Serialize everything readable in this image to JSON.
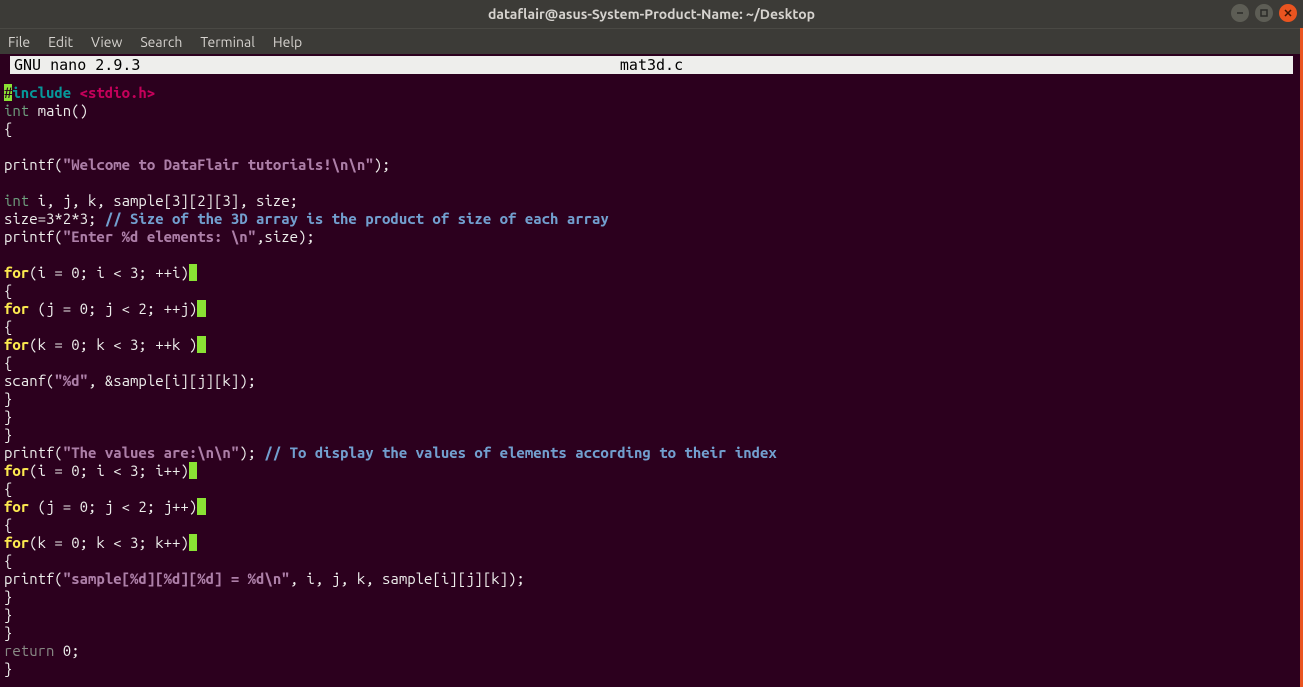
{
  "titlebar": {
    "title": "dataflair@asus-System-Product-Name: ~/Desktop"
  },
  "menubar": {
    "items": [
      "File",
      "Edit",
      "View",
      "Search",
      "Terminal",
      "Help"
    ]
  },
  "nano": {
    "editor": "  GNU nano 2.9.3",
    "filename": "mat3d.c"
  },
  "code": {
    "l1a": "#",
    "l1b": "include ",
    "l1c": "<stdio.h>",
    "l2a": "int",
    "l2b": " main()",
    "l3": "{",
    "l4": "",
    "l5a": "printf(",
    "l5b": "\"Welcome to DataFlair tutorials!\\n\\n\"",
    "l5c": ");",
    "l6": "",
    "l7a": "int",
    "l7b": " i, j, k, sample[3][2][3], size;",
    "l8a": "size=3*2*3; ",
    "l8b": "// Size of the 3D array is the product of size of each array",
    "l9a": "printf(",
    "l9b": "\"Enter %d elements: \\n\"",
    "l9c": ",size);",
    "l10": "",
    "l11a": "for",
    "l11b": "(i = 0; i < 3; ++i)",
    "l11c": " ",
    "l12": "{",
    "l13a": "for",
    "l13b": " (j = 0; j < 2; ++j)",
    "l13c": " ",
    "l14": "{",
    "l15a": "for",
    "l15b": "(k = 0; k < 3; ++k )",
    "l15c": " ",
    "l16": "{",
    "l17a": "scanf(",
    "l17b": "\"%d\"",
    "l17c": ", &sample[i][j][k]);",
    "l18": "}",
    "l19": "}",
    "l20": "}",
    "l21a": "printf(",
    "l21b": "\"The values are:\\n\\n\"",
    "l21c": "); ",
    "l21d": "// To display the values of elements according to their index",
    "l22a": "for",
    "l22b": "(i = 0; i < 3; i++)",
    "l22c": " ",
    "l23": "{",
    "l24a": "for",
    "l24b": " (j = 0; j < 2; j++)",
    "l24c": " ",
    "l25": "{",
    "l26a": "for",
    "l26b": "(k = 0; k < 3; k++)",
    "l26c": " ",
    "l27": "{",
    "l28a": "printf(",
    "l28b": "\"sample[%d][%d][%d] = %d\\n\"",
    "l28c": ", i, j, k, sample[i][j][k]);",
    "l29": "}",
    "l30": "}",
    "l31": "}",
    "l32a": "return",
    "l32b": " 0;",
    "l33": "}"
  }
}
